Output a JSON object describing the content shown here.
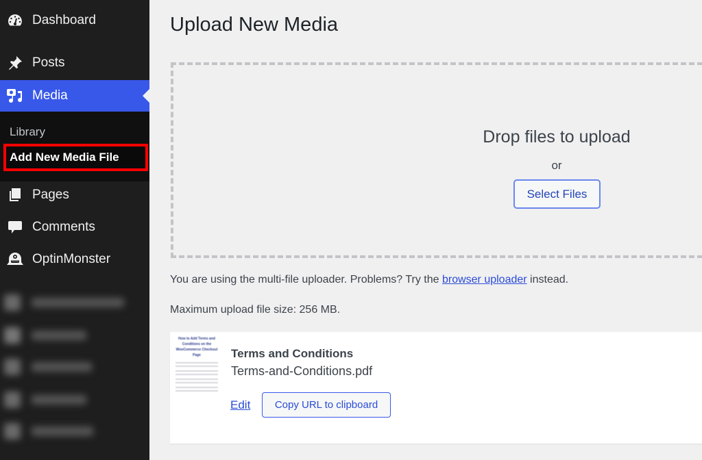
{
  "sidebar": {
    "items": [
      {
        "label": "Dashboard",
        "icon": "dashboard-icon"
      },
      {
        "label": "Posts",
        "icon": "pushpin-icon"
      },
      {
        "label": "Media",
        "icon": "media-icon",
        "active": true
      },
      {
        "label": "Pages",
        "icon": "pages-icon"
      },
      {
        "label": "Comments",
        "icon": "comment-icon"
      },
      {
        "label": "OptinMonster",
        "icon": "optinmonster-icon"
      }
    ],
    "submenu": {
      "library": "Library",
      "add_new": "Add New Media File"
    },
    "accent_color": "#3858e9",
    "highlight_color": "#ff0000"
  },
  "main": {
    "title": "Upload New Media",
    "dropzone": {
      "title": "Drop files to upload",
      "or": "or",
      "select_button": "Select Files"
    },
    "uploader_note": {
      "prefix": "You are using the multi-file uploader. Problems? Try the ",
      "link": "browser uploader",
      "suffix": " instead."
    },
    "max_size": "Maximum upload file size: 256 MB.",
    "media_item": {
      "thumbnail_title": "How to Add Terms and Conditions on the WooCommerce Checkout Page",
      "title": "Terms and Conditions",
      "filename": "Terms-and-Conditions.pdf",
      "edit_label": "Edit",
      "copy_button": "Copy URL to clipboard"
    }
  }
}
